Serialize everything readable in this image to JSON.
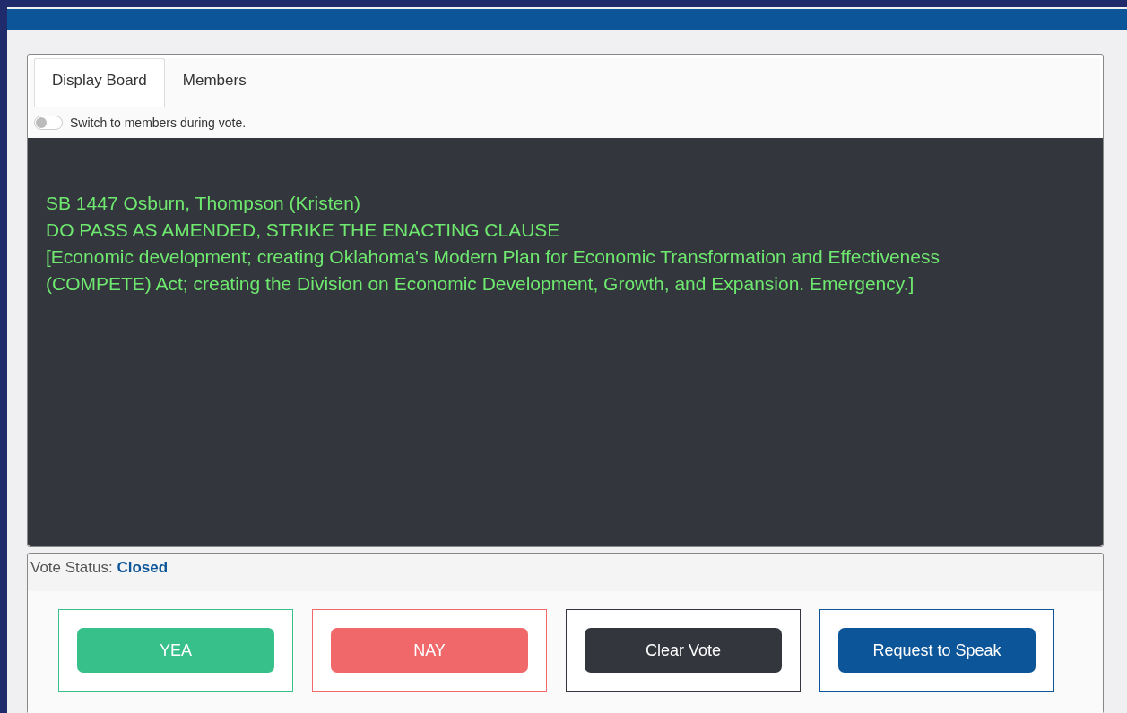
{
  "tabs": [
    {
      "label": "Display Board",
      "selected": true
    },
    {
      "label": "Members",
      "selected": false
    }
  ],
  "switch": {
    "label": "Switch to members during vote.",
    "on": false
  },
  "board": {
    "lines": [
      "SB 1447 Osburn, Thompson (Kristen)",
      "DO PASS AS AMENDED, STRIKE THE ENACTING CLAUSE",
      "[Economic development; creating Oklahoma's Modern Plan for Economic Transformation and Effectiveness (COMPETE) Act; creating the Division on Economic Development, Growth, and Expansion. Emergency.]"
    ]
  },
  "vote_status": {
    "label": "Vote Status:",
    "value": "Closed"
  },
  "buttons": [
    {
      "label": "YEA",
      "color": "#37c08a"
    },
    {
      "label": "NAY",
      "color": "#f0686a"
    },
    {
      "label": "Clear Vote",
      "color": "#33363d"
    },
    {
      "label": "Request to Speak",
      "color": "#0b5598"
    }
  ]
}
